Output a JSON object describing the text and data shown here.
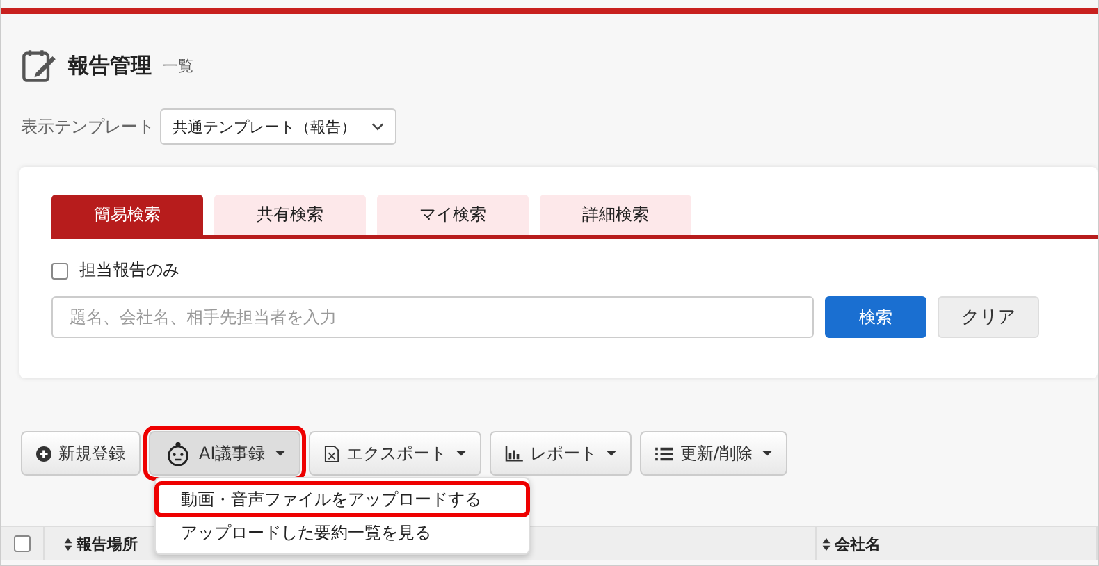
{
  "page": {
    "title": "報告管理",
    "subtitle": "一覧"
  },
  "template": {
    "label": "表示テンプレート",
    "value": "共通テンプレート（報告）"
  },
  "search_tabs": [
    {
      "label": "簡易検索",
      "selected": true
    },
    {
      "label": "共有検索",
      "selected": false
    },
    {
      "label": "マイ検索",
      "selected": false
    },
    {
      "label": "詳細検索",
      "selected": false
    }
  ],
  "filter": {
    "label": "担当報告のみ",
    "checked": false
  },
  "search": {
    "placeholder": "題名、会社名、相手先担当者を入力",
    "submit": "検索",
    "clear": "クリア"
  },
  "toolbar": [
    {
      "kind": "plus",
      "label": "新規登録",
      "dropdown": false,
      "highlighted": false
    },
    {
      "kind": "ai",
      "label": "AI議事録",
      "dropdown": true,
      "highlighted": true
    },
    {
      "kind": "export",
      "label": "エクスポート",
      "dropdown": true,
      "highlighted": false
    },
    {
      "kind": "chart",
      "label": "レポート",
      "dropdown": true,
      "highlighted": false
    },
    {
      "kind": "list",
      "label": "更新/削除",
      "dropdown": true,
      "highlighted": false
    }
  ],
  "menu": [
    {
      "label": "動画・音声ファイルをアップロードする",
      "highlighted": true
    },
    {
      "label": "アップロードした要約一覧を見る",
      "highlighted": false
    }
  ],
  "table": {
    "all_checked": false,
    "columns": [
      "報告場所",
      "会社名"
    ]
  }
}
